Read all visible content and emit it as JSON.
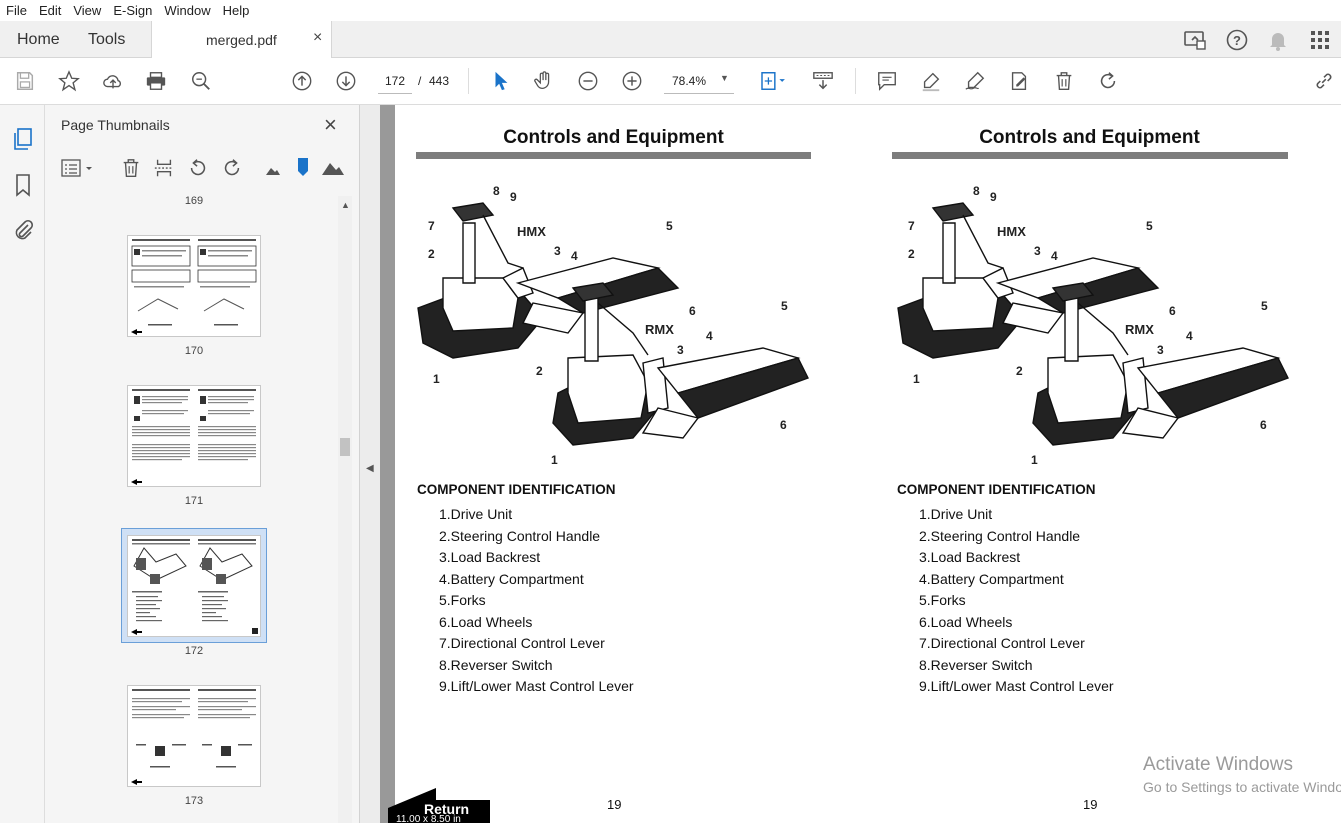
{
  "menu": [
    "File",
    "Edit",
    "View",
    "E-Sign",
    "Window",
    "Help"
  ],
  "tabs": {
    "home": "Home",
    "tools": "Tools",
    "document": "merged.pdf",
    "close": "×"
  },
  "toolbar": {
    "current_page": "172",
    "page_sep": "/",
    "total_pages": "443",
    "zoom": "78.4%"
  },
  "panel": {
    "title": "Page Thumbnails",
    "close": "×",
    "top_label": "169",
    "thumbnails": [
      {
        "label": "170",
        "selected": false
      },
      {
        "label": "171",
        "selected": false
      },
      {
        "label": "172",
        "selected": true
      },
      {
        "label": "173",
        "selected": false
      }
    ]
  },
  "document": {
    "left": {
      "title": "Controls and Equipment",
      "section": "COMPONENT IDENTIFICATION",
      "items": [
        "1.Drive Unit",
        "2.Steering Control Handle",
        "3.Load Backrest",
        "4.Battery Compartment",
        "5.Forks",
        "6.Load Wheels",
        "7.Directional Control Lever",
        "8.Reverser Switch",
        "9.Lift/Lower Mast Control Lever"
      ],
      "page_number": "19"
    },
    "right": {
      "title": "Controls and Equipment",
      "section": "COMPONENT IDENTIFICATION",
      "items": [
        "1.Drive Unit",
        "2.Steering Control Handle",
        "3.Load Backrest",
        "4.Battery Compartment",
        "5.Forks",
        "6.Load Wheels",
        "7.Directional Control Lever",
        "8.Reverser Switch",
        "9.Lift/Lower Mast Control Lever"
      ],
      "page_number": "19"
    },
    "illustration": {
      "label_hmx": "HMX",
      "label_rmx": "RMX",
      "callouts": [
        "1",
        "2",
        "3",
        "4",
        "5",
        "6",
        "7",
        "8",
        "9"
      ]
    },
    "return_label": "Return",
    "page_size": "11.00 x 8.50 in"
  },
  "watermark": {
    "line1": "Activate Windows",
    "line2": "Go to Settings to activate Windows."
  }
}
